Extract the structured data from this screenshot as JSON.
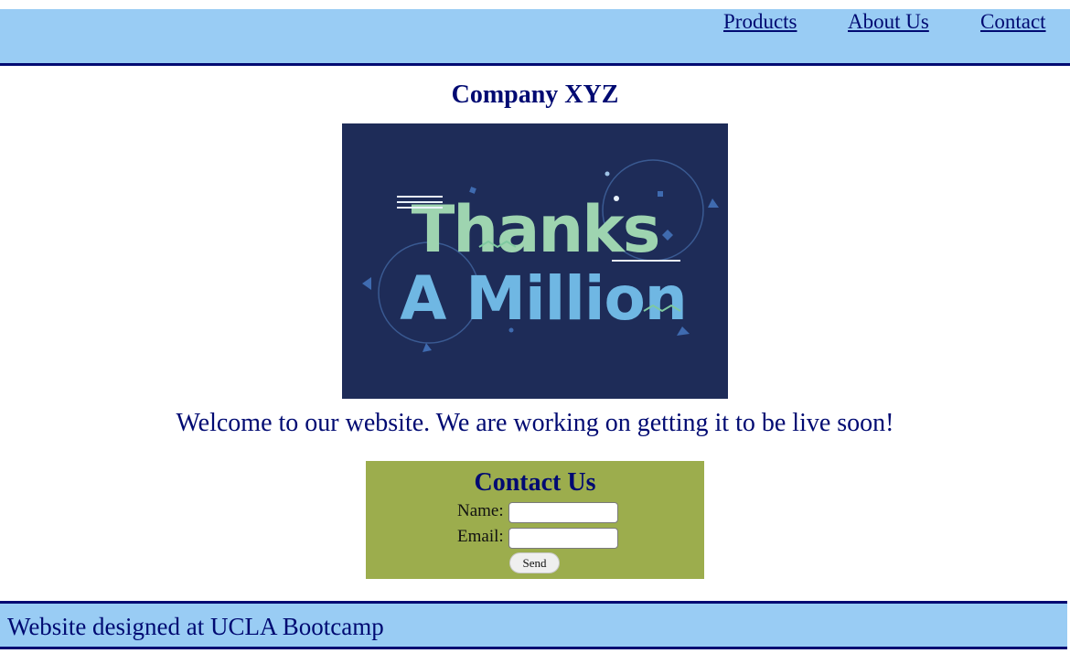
{
  "nav": {
    "products": "Products",
    "about": "About Us",
    "contact": "Contact"
  },
  "main": {
    "title": "Company XYZ",
    "hero_image_text_line1": "Thanks",
    "hero_image_text_line2": "A Million",
    "welcome": "Welcome to our website. We are working on getting it to be live soon!"
  },
  "contact_form": {
    "title": "Contact Us",
    "name_label": "Name:",
    "email_label": "Email:",
    "name_value": "",
    "email_value": "",
    "send_label": "Send"
  },
  "footer": {
    "text": "Website designed at UCLA Bootcamp"
  },
  "colors": {
    "nav_bg": "#99ccf4",
    "accent_navy": "#000a72",
    "form_bg": "#9cad4d",
    "hero_bg": "#1e2c58"
  }
}
